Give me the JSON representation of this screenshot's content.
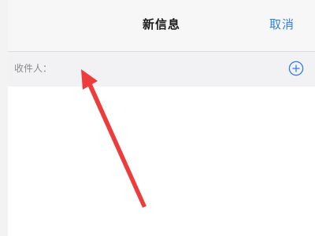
{
  "header": {
    "title": "新信息",
    "cancel_label": "取消"
  },
  "recipient": {
    "label": "收件人：",
    "value": ""
  },
  "icons": {
    "add": "plus-circle-icon",
    "annotation": "red-arrow-icon"
  },
  "colors": {
    "accent": "#2f7fe0",
    "annotation_arrow": "#ee3b3b",
    "nav_background": "#f7f7f8",
    "recipient_background": "#f2f2f4"
  }
}
